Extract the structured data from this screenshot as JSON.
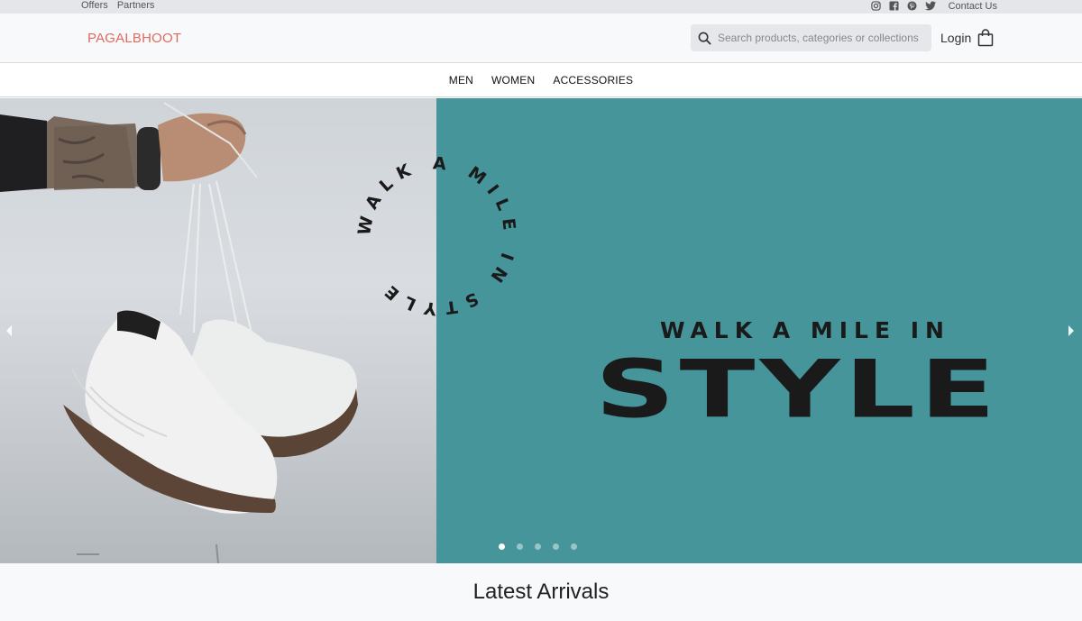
{
  "topbar": {
    "links": [
      "Offers",
      "Partners"
    ],
    "social_icons": [
      "instagram-icon",
      "facebook-icon",
      "pinterest-icon",
      "twitter-icon"
    ],
    "contact": "Contact Us"
  },
  "header": {
    "logo": "PAGALBHOOT",
    "search_placeholder": "Search products, categories or collections",
    "login": "Login"
  },
  "nav": {
    "items": [
      "MEN",
      "WOMEN",
      "ACCESSORIES"
    ]
  },
  "hero": {
    "circle_text": "WALK A MILE IN STYLE",
    "headline_small": "WALK A MILE IN",
    "headline_big": "STYLE",
    "slides_count": 5,
    "active_slide": 1,
    "colors": {
      "teal": "#45959a",
      "logo": "#e06a5e"
    }
  },
  "section": {
    "title": "Latest Arrivals"
  }
}
